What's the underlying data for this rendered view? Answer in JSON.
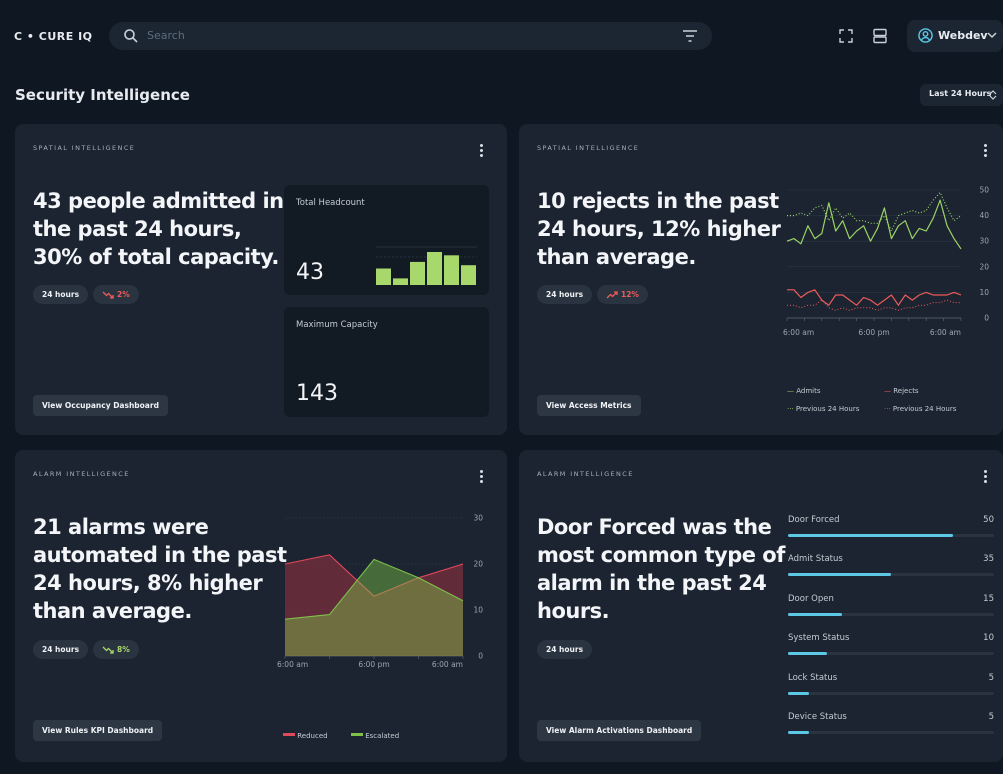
{
  "app": {
    "logo": "C • CURE IQ"
  },
  "search": {
    "placeholder": "Search"
  },
  "user": {
    "name": "Webdev"
  },
  "page": {
    "title": "Security Intelligence",
    "time_range": "Last 24 Hours"
  },
  "colors": {
    "accent": "#5cc8e6",
    "admits": "#9bd465",
    "rejects": "#ef5b5b",
    "reduced": "#e0485b",
    "escalated": "#7ec04a"
  },
  "cards": {
    "occupancy": {
      "tag": "SPATIAL INTELLIGENCE",
      "headline": [
        "43 people admitted in",
        "the past 24 hours,",
        "30% of total capacity."
      ],
      "pill_range": "24 hours",
      "pill_change": "2%",
      "button": "View Occupancy Dashboard",
      "headcount_label": "Total Headcount",
      "headcount_value": "43",
      "capacity_label": "Maximum Capacity",
      "capacity_value": "143",
      "sparkbars": [
        5,
        2,
        7,
        10,
        9,
        6
      ]
    },
    "access": {
      "tag": "SPATIAL INTELLIGENCE",
      "headline": [
        "10 rejects in the past",
        "24 hours, 12% higher",
        "than average."
      ],
      "pill_range": "24 hours",
      "pill_change": "12%",
      "button": "View Access Metrics",
      "legend": {
        "admits": "Admits",
        "rejects": "Rejects",
        "prev_admits": "Previous 24 Hours",
        "prev_rejects": "Previous 24 Hours"
      }
    },
    "alarms": {
      "tag": "ALARM INTELLIGENCE",
      "headline": [
        "21 alarms were",
        "automated in the past",
        "24 hours, 8% higher",
        "than average."
      ],
      "pill_range": "24 hours",
      "pill_change": "8%",
      "button": "View Rules KPI Dashboard",
      "legend": {
        "reduced": "Reduced",
        "escalated": "Escalated"
      }
    },
    "alarm_types": {
      "tag": "ALARM INTELLIGENCE",
      "headline": [
        "Door Forced was the",
        "most common type of",
        "alarm in the past 24",
        "hours."
      ],
      "pill_range": "24 hours",
      "button": "View Alarm Activations Dashboard",
      "rows": [
        {
          "label": "Door Forced",
          "value": "50",
          "fraction": 0.8
        },
        {
          "label": "Admit Status",
          "value": "35",
          "fraction": 0.5
        },
        {
          "label": "Door Open",
          "value": "15",
          "fraction": 0.26
        },
        {
          "label": "System Status",
          "value": "10",
          "fraction": 0.19
        },
        {
          "label": "Lock Status",
          "value": "5",
          "fraction": 0.1
        },
        {
          "label": "Device Status",
          "value": "5",
          "fraction": 0.1
        }
      ]
    }
  },
  "chart_data": [
    {
      "type": "line",
      "x": [
        "6:00 am",
        "",
        "",
        "",
        "",
        "6:00 pm",
        "",
        "",
        "",
        "",
        "6:00 am"
      ],
      "y_ticks": [
        "50",
        "40",
        "30",
        "20",
        "10",
        "0"
      ],
      "ylim": [
        0,
        50
      ],
      "series": [
        {
          "name": "Admits",
          "values": [
            30,
            31,
            29,
            36,
            31,
            33,
            45,
            34,
            38,
            31,
            34,
            36,
            30,
            35,
            43,
            31,
            36,
            38,
            31,
            35,
            34,
            39,
            46,
            36,
            31,
            27
          ]
        },
        {
          "name": "Rejects",
          "values": [
            11,
            11,
            8,
            10,
            11,
            7,
            5,
            9,
            9,
            7,
            5,
            8,
            7,
            5,
            7,
            9,
            5,
            9,
            7,
            9,
            10,
            9,
            9,
            9,
            10,
            9
          ]
        },
        {
          "name": "Previous 24 Hours",
          "values": [
            40,
            40,
            41,
            40,
            43,
            44,
            38,
            43,
            39,
            41,
            38,
            38,
            37,
            37,
            40,
            34,
            40,
            41,
            42,
            41,
            42,
            46,
            49,
            43,
            38,
            40
          ]
        },
        {
          "name": "Previous 24 Hours",
          "values": [
            5,
            5,
            4,
            5,
            5,
            7,
            4,
            3,
            4,
            3,
            4,
            4,
            4,
            3,
            4,
            4,
            3,
            4,
            4,
            5,
            5,
            6,
            6,
            7,
            6,
            6
          ]
        }
      ]
    },
    {
      "type": "area",
      "x": [
        "6:00 am",
        "",
        "6:00 pm",
        "",
        "6:00 am"
      ],
      "y_ticks": [
        "30",
        "20",
        "10",
        "0"
      ],
      "ylim": [
        0,
        30
      ],
      "series": [
        {
          "name": "Reduced",
          "values": [
            20,
            22,
            13,
            17,
            20
          ]
        },
        {
          "name": "Escalated",
          "values": [
            8,
            9,
            21,
            17,
            12
          ]
        }
      ]
    }
  ]
}
